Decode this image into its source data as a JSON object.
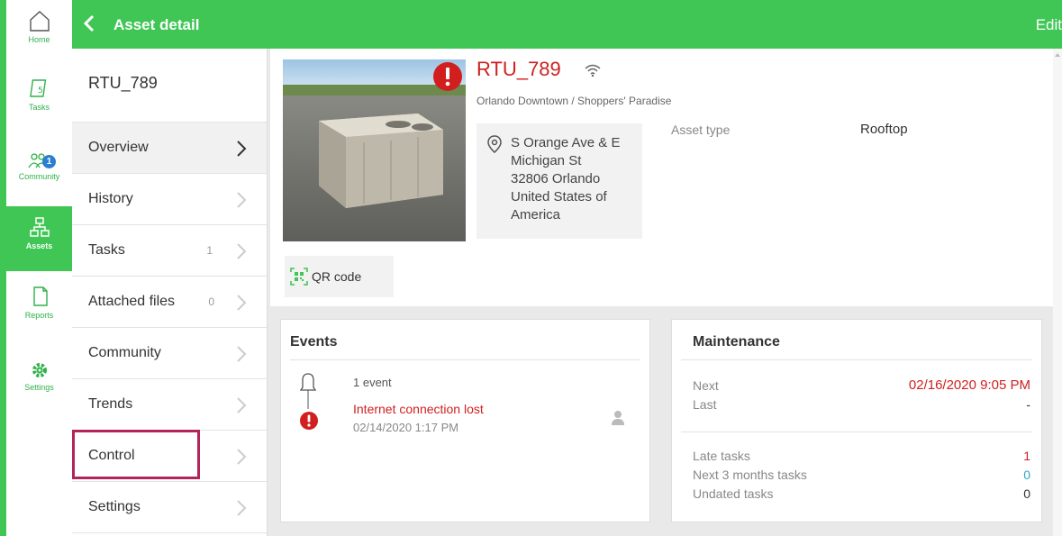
{
  "nav": {
    "items": [
      {
        "label": "Home",
        "icon": "home-icon"
      },
      {
        "label": "Tasks",
        "icon": "tasks-icon"
      },
      {
        "label": "Community",
        "icon": "community-icon",
        "badge": "1"
      },
      {
        "label": "Assets",
        "icon": "assets-icon",
        "active": true
      },
      {
        "label": "Reports",
        "icon": "reports-icon"
      },
      {
        "label": "Settings",
        "icon": "settings-icon"
      }
    ]
  },
  "header": {
    "title": "Asset detail",
    "edit_label": "Edit"
  },
  "submenu": {
    "asset_id": "RTU_789",
    "items": [
      {
        "label": "Overview",
        "active": true
      },
      {
        "label": "History"
      },
      {
        "label": "Tasks",
        "count": "1"
      },
      {
        "label": "Attached files",
        "count": "0"
      },
      {
        "label": "Community"
      },
      {
        "label": "Trends"
      },
      {
        "label": "Control"
      },
      {
        "label": "Settings"
      }
    ]
  },
  "asset": {
    "name": "RTU_789",
    "location": "Orlando Downtown / Shoppers' Paradise",
    "address_lines": [
      "S Orange Ave & E",
      "Michigan St",
      "32806 Orlando",
      "United States of",
      "America"
    ],
    "type_label": "Asset type",
    "type_value": "Rooftop",
    "qr_label": "QR code"
  },
  "events": {
    "title": "Events",
    "count_text": "1 event",
    "message": "Internet connection lost",
    "timestamp": "02/14/2020 1:17 PM"
  },
  "maintenance": {
    "title": "Maintenance",
    "next_label": "Next",
    "next_value": "02/16/2020 9:05 PM",
    "last_label": "Last",
    "last_value": "-",
    "late_label": "Late tasks",
    "late_value": "1",
    "next3_label": "Next 3 months tasks",
    "next3_value": "0",
    "undated_label": "Undated tasks",
    "undated_value": "0"
  },
  "colors": {
    "brand_green": "#3fc655",
    "alert_red": "#d11f1f",
    "highlight": "#b1255a",
    "info_blue": "#2ba6cc"
  }
}
